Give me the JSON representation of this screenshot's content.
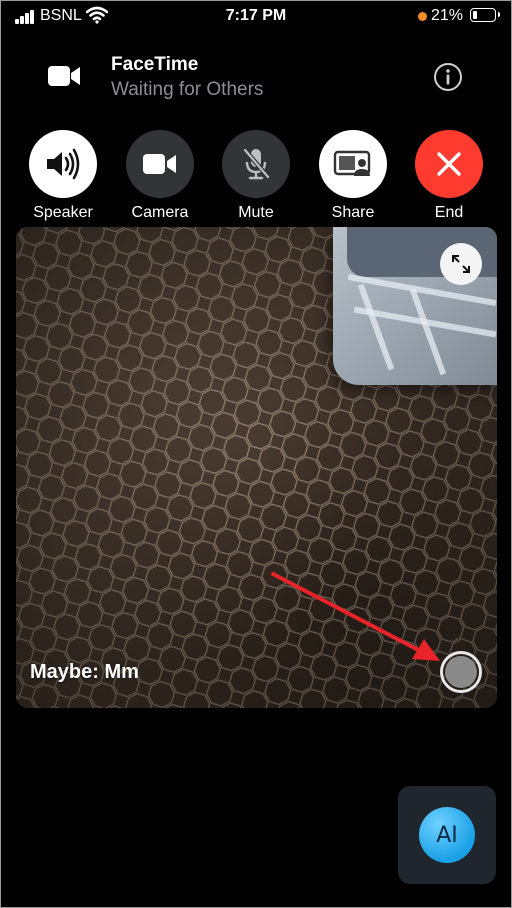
{
  "status_bar": {
    "carrier": "BSNL",
    "time": "7:17 PM",
    "battery_percent": "21%",
    "battery_level": 0.21
  },
  "header": {
    "app_name": "FaceTime",
    "subtitle": "Waiting for Others",
    "icons": {
      "camera": "video-camera-icon",
      "info": "info-icon"
    }
  },
  "controls": [
    {
      "label": "Speaker",
      "icon": "speaker-icon"
    },
    {
      "label": "Camera",
      "icon": "video-camera-icon"
    },
    {
      "label": "Mute",
      "icon": "microphone-slash-icon"
    },
    {
      "label": "Share",
      "icon": "share-screen-icon"
    },
    {
      "label": "End",
      "icon": "close-icon"
    }
  ],
  "video": {
    "caption": "Maybe: Mm",
    "expand_icon": "expand-icon",
    "shutter_icon": "live-photo-shutter-icon"
  },
  "ai_button": {
    "label": "AI"
  },
  "colors": {
    "end_red": "#ff3b30",
    "annotation_arrow": "#e8232a",
    "battery_dot": "#f28c28",
    "subtitle_gray": "#8e8e93"
  }
}
